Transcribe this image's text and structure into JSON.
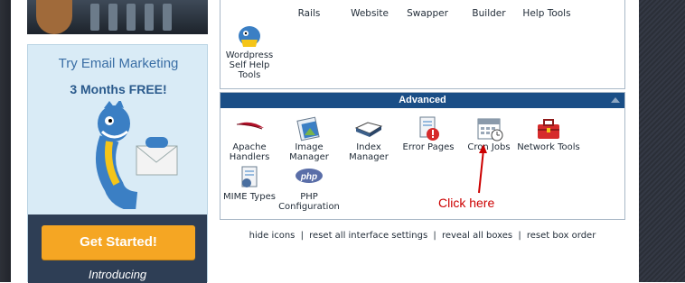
{
  "promo": {
    "title": "Try Email Marketing",
    "subtitle": "3 Months FREE!",
    "cta_label": "Get Started!",
    "footer_text": "Introducing"
  },
  "top_box": {
    "partial_labels": [
      "Rails",
      "Website",
      "Swapper",
      "Builder",
      "Help Tools"
    ],
    "wordpress_label": "Wordpress Self Help Tools"
  },
  "advanced": {
    "header": "Advanced",
    "items": [
      {
        "label": "Apache Handlers",
        "icon": "feather-icon"
      },
      {
        "label": "Image Manager",
        "icon": "image-manager-icon"
      },
      {
        "label": "Index Manager",
        "icon": "book-icon"
      },
      {
        "label": "Error Pages",
        "icon": "error-page-icon"
      },
      {
        "label": "Cron Jobs",
        "icon": "calendar-icon"
      },
      {
        "label": "Network Tools",
        "icon": "toolbox-icon"
      },
      {
        "label": "MIME Types",
        "icon": "mime-document-icon"
      },
      {
        "label": "PHP Configuration",
        "icon": "php-icon"
      }
    ]
  },
  "annotation": {
    "text": "Click here",
    "color": "#cc0000"
  },
  "footer_links": [
    "hide icons",
    "reset all interface settings",
    "reveal all boxes",
    "reset box order"
  ],
  "colors": {
    "header_blue": "#1a4e86",
    "cta_orange": "#f5a623",
    "promo_bg": "#d9ebf6"
  }
}
